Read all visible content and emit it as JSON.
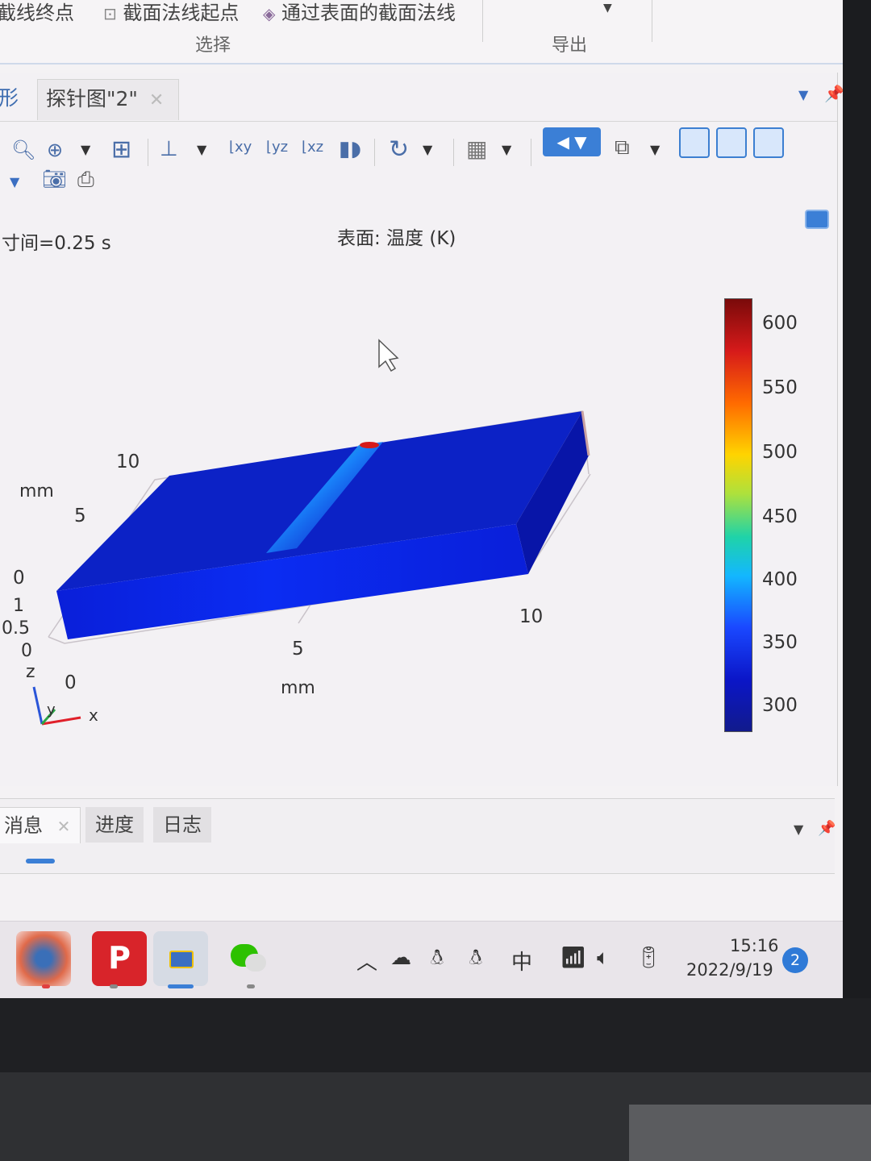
{
  "ribbon": {
    "item_endpoint": "截线终点",
    "item_startpoint": "截面法线起点",
    "item_surface_normal": "通过表面的截面法线",
    "group_select": "选择",
    "group_export": "导出"
  },
  "window": {
    "left_tab_fragment": "形",
    "active_tab": "探针图\"2\"",
    "tab_close": "✕"
  },
  "plot": {
    "time_label": "寸间=0.25 s",
    "title": "表面: 温度 (K)",
    "colorbar_ticks": [
      "600",
      "550",
      "500",
      "450",
      "400",
      "350",
      "300"
    ],
    "axis_y_ticks": [
      "10",
      "5",
      "0"
    ],
    "axis_y_unit": "mm",
    "axis_z_ticks": [
      "1",
      "0.5",
      "0"
    ],
    "axis_z_label": "z",
    "axis_x_ticks": [
      "0",
      "5",
      "10"
    ],
    "axis_x_unit": "mm",
    "triad_x": "x",
    "triad_y": "y",
    "colors": {
      "block_top": "#0c22c6",
      "block_side": "#0a1fd9",
      "hot": "#d61a1a"
    }
  },
  "messages": {
    "tab_messages": "消息",
    "tab_progress": "进度",
    "tab_log": "日志"
  },
  "taskbar": {
    "ime": "中",
    "time": "15:16",
    "date": "2022/9/19",
    "notifications": "2"
  }
}
